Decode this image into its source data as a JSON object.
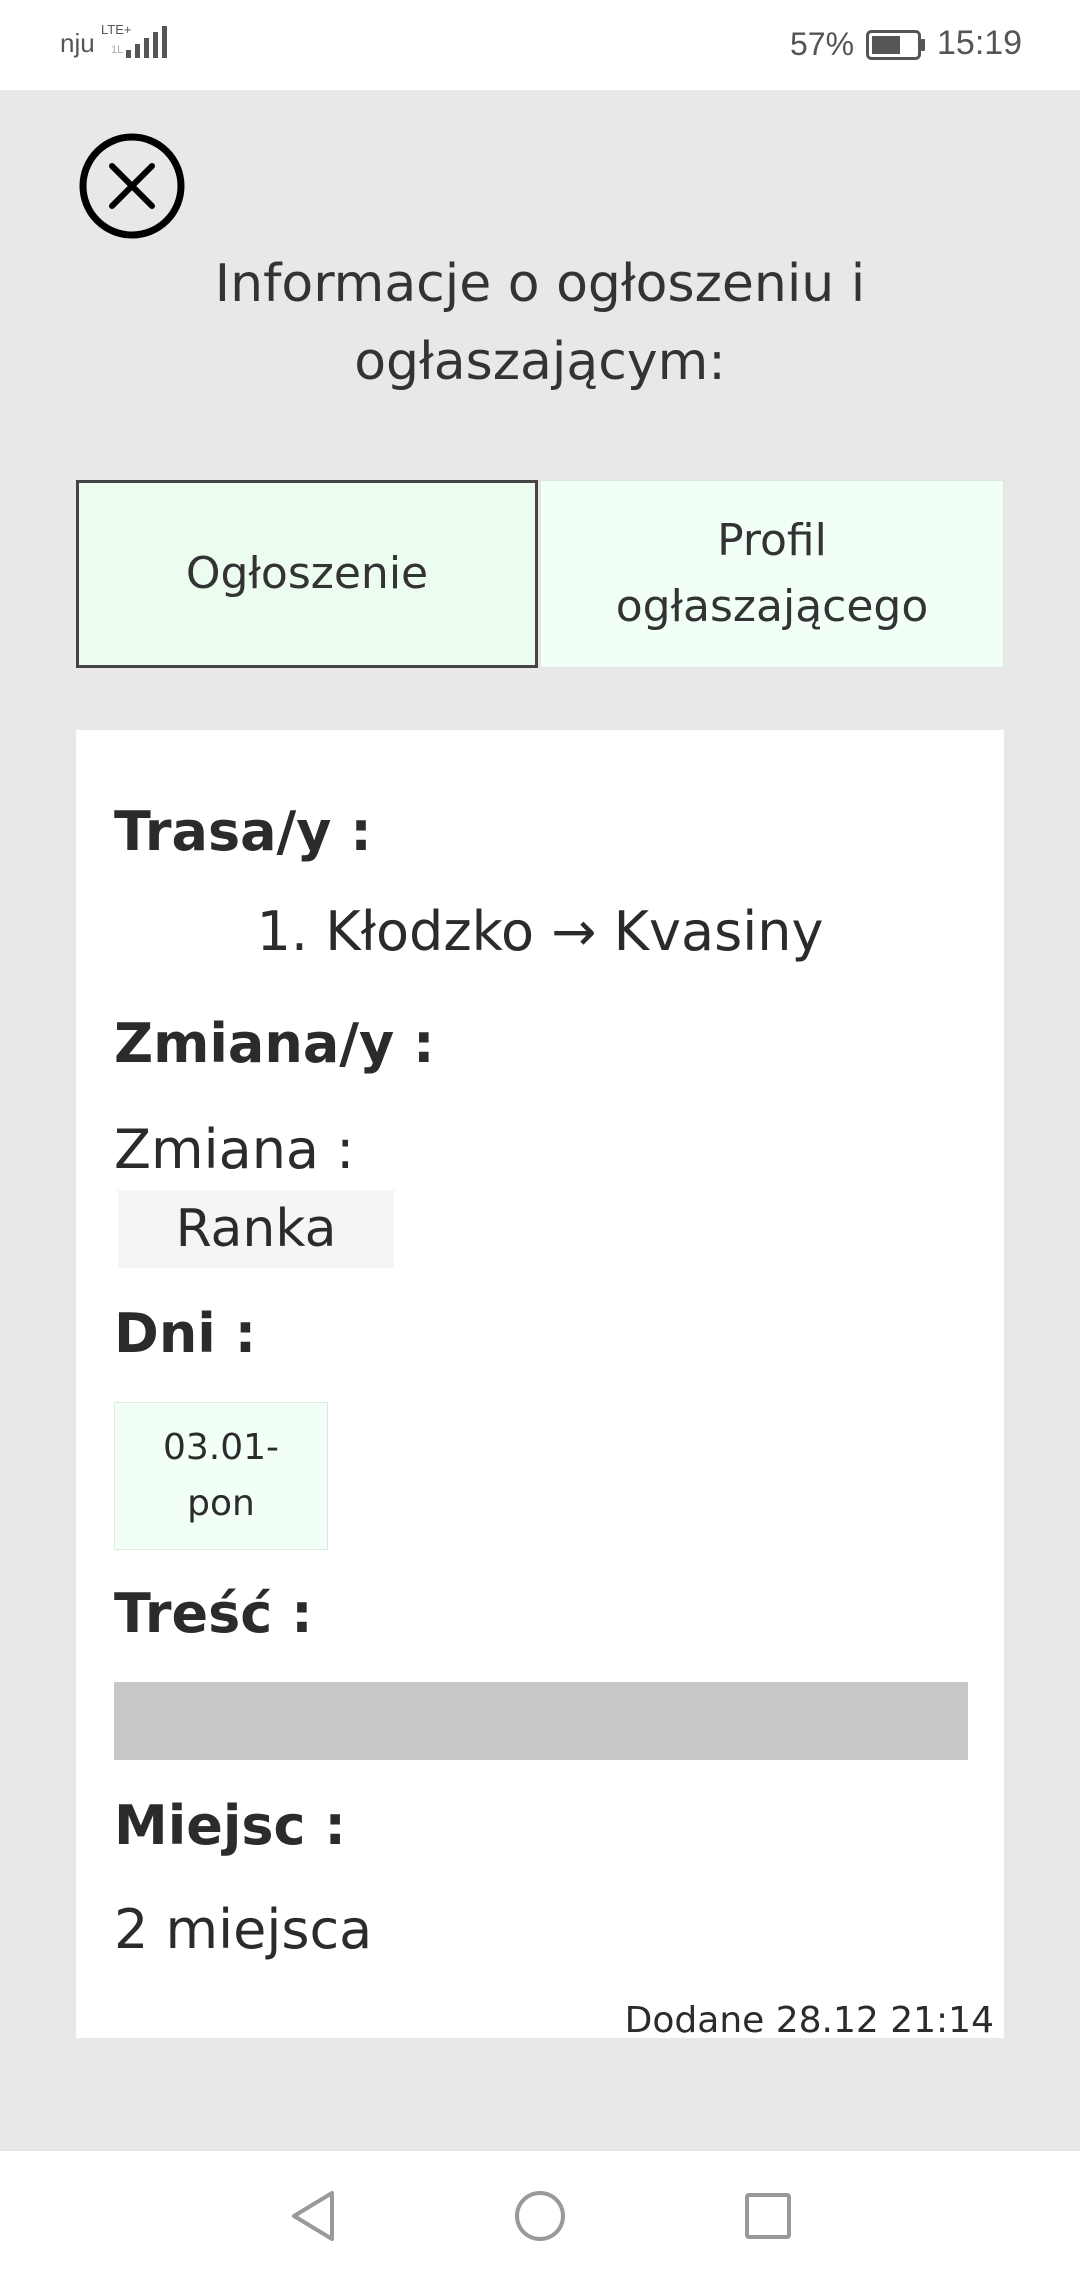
{
  "status_bar": {
    "carrier": "nju",
    "network": "LTE+",
    "network_sub": "1L",
    "battery_percent": "57%",
    "time": "15:19",
    "icons": [
      "signal-icon",
      "battery-icon"
    ]
  },
  "header": {
    "close_icon": "close-circle-icon",
    "title": "Informacje o ogłoszeniu i ogłaszającym:"
  },
  "tabs": [
    {
      "label": "Ogłoszenie",
      "active": true
    },
    {
      "label": "Profil ogłaszającego",
      "active": false
    }
  ],
  "details": {
    "routes_label": "Trasa/y :",
    "routes": [
      "1. Kłodzko → Kvasiny"
    ],
    "shifts_label": "Zmiana/y :",
    "shift_label": "Zmiana :",
    "shift_value": "Ranka",
    "days_label": "Dni :",
    "days": [
      "03.01- pon"
    ],
    "content_label": "Treść :",
    "seats_label": "Miejsc :",
    "seats_value": "2 miejsca",
    "added": "Dodane 28.12 21:14"
  },
  "nav_bar": {
    "icons": [
      "back-icon",
      "home-icon",
      "recents-icon"
    ]
  },
  "colors": {
    "background": "#e8e8e8",
    "tab_active_bg": "#ecfcee",
    "tab_inactive_bg": "#f1fff7",
    "content_box": "#c8c8c8"
  }
}
